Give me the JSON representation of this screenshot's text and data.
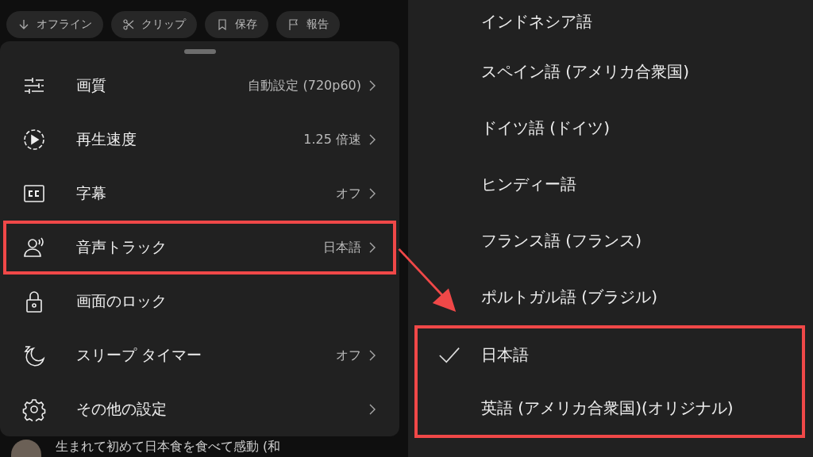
{
  "action_chips": [
    {
      "label": "オフライン"
    },
    {
      "label": "クリップ"
    },
    {
      "label": "保存"
    },
    {
      "label": "報告"
    }
  ],
  "settings_sheet": {
    "items": [
      {
        "label": "画質",
        "value": "自動設定 (720p60)",
        "highlighted": false
      },
      {
        "label": "再生速度",
        "value": "1.25 倍速",
        "highlighted": false
      },
      {
        "label": "字幕",
        "value": "オフ",
        "highlighted": false
      },
      {
        "label": "音声トラック",
        "value": "日本語",
        "highlighted": true
      },
      {
        "label": "画面のロック",
        "highlighted": false
      },
      {
        "label": "スリープ タイマー",
        "value": "オフ",
        "highlighted": false
      },
      {
        "label": "その他の設定",
        "value": "",
        "highlighted": false
      }
    ]
  },
  "video_caption": "生まれて初めて日本食を食べて感動 (和",
  "audio_tracks": [
    {
      "label": "インドネシア語",
      "selected": false,
      "highlighted": false
    },
    {
      "label": "スペイン語 (アメリカ合衆国)",
      "selected": false,
      "highlighted": false
    },
    {
      "label": "ドイツ語 (ドイツ)",
      "selected": false,
      "highlighted": false
    },
    {
      "label": "ヒンディー語",
      "selected": false,
      "highlighted": false
    },
    {
      "label": "フランス語 (フランス)",
      "selected": false,
      "highlighted": false
    },
    {
      "label": "ポルトガル語 (ブラジル)",
      "selected": false,
      "highlighted": false
    },
    {
      "label": "日本語",
      "selected": true,
      "highlighted": true
    },
    {
      "label": "英語 (アメリカ合衆国)(オリジナル)",
      "selected": false,
      "highlighted": true
    }
  ]
}
